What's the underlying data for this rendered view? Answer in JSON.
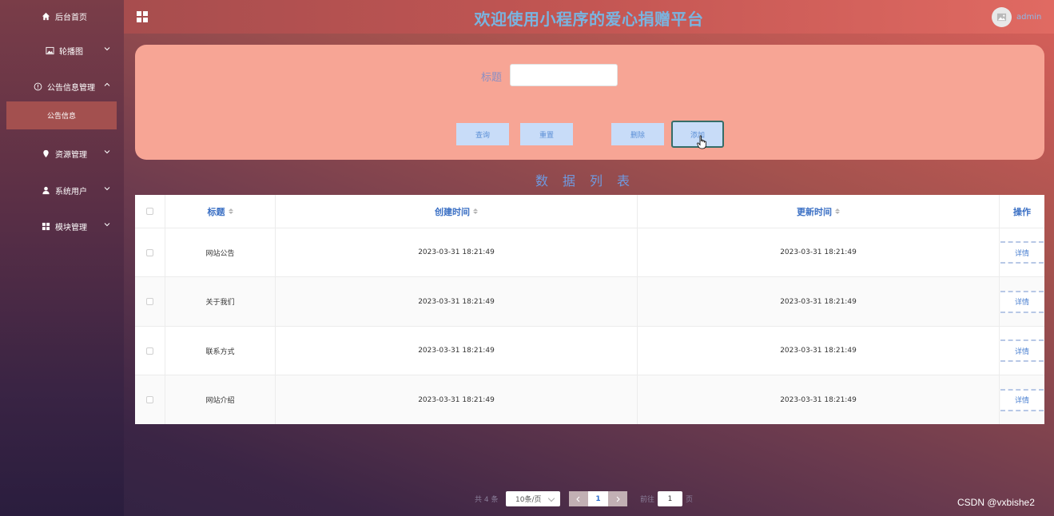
{
  "sidebar": {
    "items": [
      {
        "label": "后台首页",
        "icon": "home-icon"
      },
      {
        "label": "轮播图",
        "icon": "image-icon"
      },
      {
        "label": "公告信息管理",
        "icon": "info-icon"
      },
      {
        "label": "资源管理",
        "icon": "location-icon"
      },
      {
        "label": "系统用户",
        "icon": "user-icon"
      },
      {
        "label": "模块管理",
        "icon": "grid-icon"
      }
    ],
    "sub_item": "公告信息"
  },
  "header": {
    "title": "欢迎使用小程序的爱心捐赠平台",
    "user": "admin"
  },
  "search": {
    "label": "标题",
    "value": "",
    "buttons": {
      "query": "查询",
      "reset": "重置",
      "delete": "删除",
      "add": "添加"
    }
  },
  "list_title": "数据列表",
  "table": {
    "columns": [
      "标题",
      "创建时间",
      "更新时间",
      "操作"
    ],
    "rows": [
      {
        "title": "网站公告",
        "created": "2023-03-31 18:21:49",
        "updated": "2023-03-31 18:21:49",
        "action": "详情"
      },
      {
        "title": "关于我们",
        "created": "2023-03-31 18:21:49",
        "updated": "2023-03-31 18:21:49",
        "action": "详情"
      },
      {
        "title": "联系方式",
        "created": "2023-03-31 18:21:49",
        "updated": "2023-03-31 18:21:49",
        "action": "详情"
      },
      {
        "title": "网站介绍",
        "created": "2023-03-31 18:21:49",
        "updated": "2023-03-31 18:21:49",
        "action": "详情"
      }
    ]
  },
  "pagination": {
    "total": "共 4 条",
    "page_size": "10条/页",
    "current": "1",
    "goto_label": "前往",
    "goto_value": "1",
    "page_suffix": "页"
  },
  "watermark": "CSDN @vxbishe2",
  "colors": {
    "accent": "#79b4e0",
    "panel": "#f7a595",
    "button": "#c8dcf8"
  }
}
